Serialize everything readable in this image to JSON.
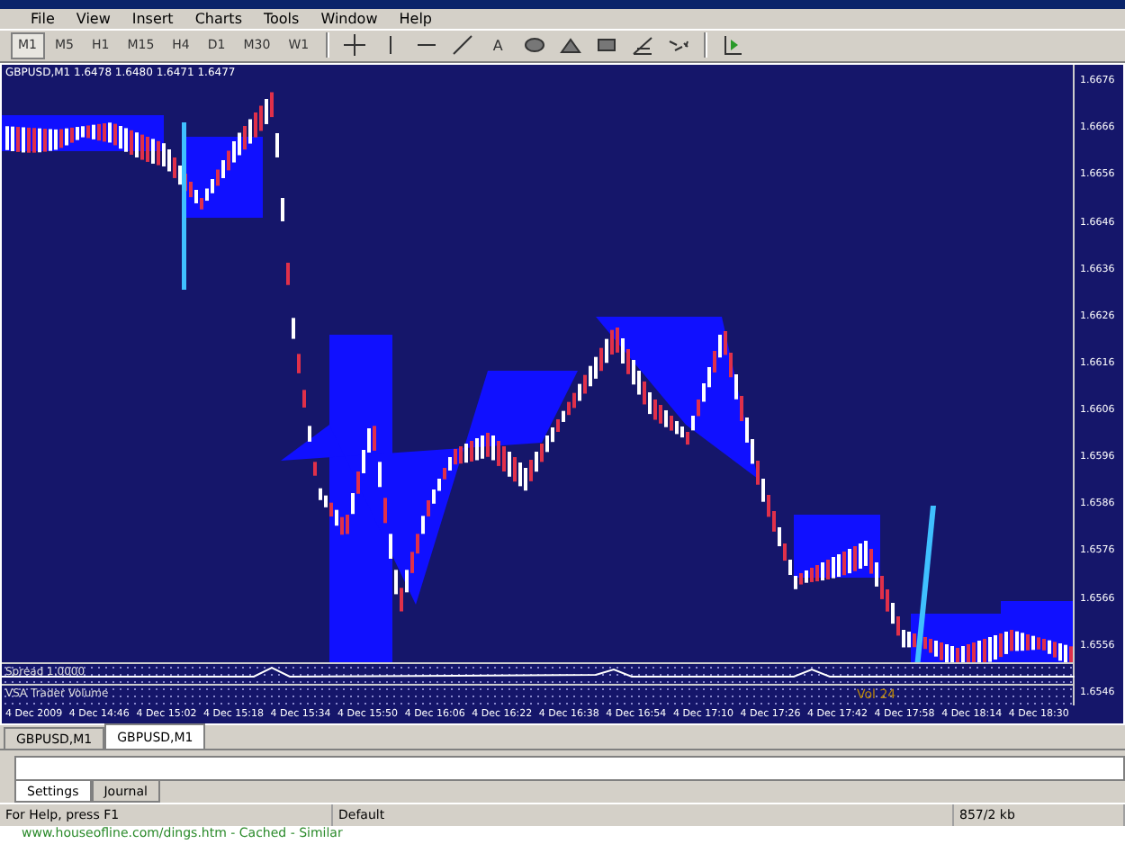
{
  "menu": [
    "File",
    "View",
    "Insert",
    "Charts",
    "Tools",
    "Window",
    "Help"
  ],
  "timeframes": [
    {
      "label": "M1",
      "selected": true
    },
    {
      "label": "M5",
      "selected": false
    },
    {
      "label": "H1",
      "selected": false
    },
    {
      "label": "M15",
      "selected": false
    },
    {
      "label": "H4",
      "selected": false
    },
    {
      "label": "D1",
      "selected": false
    },
    {
      "label": "M30",
      "selected": false
    },
    {
      "label": "W1",
      "selected": false
    }
  ],
  "tools": [
    {
      "kind": "crosshair"
    },
    {
      "kind": "vline"
    },
    {
      "kind": "hline"
    },
    {
      "kind": "trend"
    },
    {
      "kind": "text",
      "label": "A"
    },
    {
      "kind": "ellipse"
    },
    {
      "kind": "triangle"
    },
    {
      "kind": "rect"
    },
    {
      "kind": "fibo"
    },
    {
      "kind": "arrows"
    },
    {
      "kind": "tester"
    }
  ],
  "chart": {
    "header": "GBPUSD,M1  1.6478 1.6480 1.6471 1.6477",
    "price_labels": [
      "1.6676",
      "1.6666",
      "1.6656",
      "1.6646",
      "1.6636",
      "1.6626",
      "1.6616",
      "1.6606",
      "1.6596",
      "1.6586",
      "1.6576",
      "1.6566",
      "1.6556",
      "1.6546"
    ],
    "indicator_labels": [
      "Spread 1.0000",
      "VSA Trader Volume"
    ],
    "volume_label": "Vol  24",
    "time_labels": [
      "4 Dec 2009",
      "4 Dec 14:46",
      "4 Dec 15:02",
      "4 Dec 15:18",
      "4 Dec 15:34",
      "4 Dec 15:50",
      "4 Dec 16:06",
      "4 Dec 16:22",
      "4 Dec 16:38",
      "4 Dec 16:54",
      "4 Dec 17:10",
      "4 Dec 17:26",
      "4 Dec 17:42",
      "4 Dec 17:58",
      "4 Dec 18:14",
      "4 Dec 18:30"
    ]
  },
  "chart_tabs": [
    {
      "label": "GBPUSD,M1",
      "selected": false
    },
    {
      "label": "GBPUSD,M1",
      "selected": true
    }
  ],
  "tester_tabs": [
    {
      "label": "Settings",
      "selected": true
    },
    {
      "label": "Journal",
      "selected": false
    }
  ],
  "status_bar": {
    "help": "For Help, press F1",
    "profile": "Default",
    "traffic": "857/2 kb"
  },
  "footer": "www.houseofline.com/dings.htm - Cached - Similar"
}
